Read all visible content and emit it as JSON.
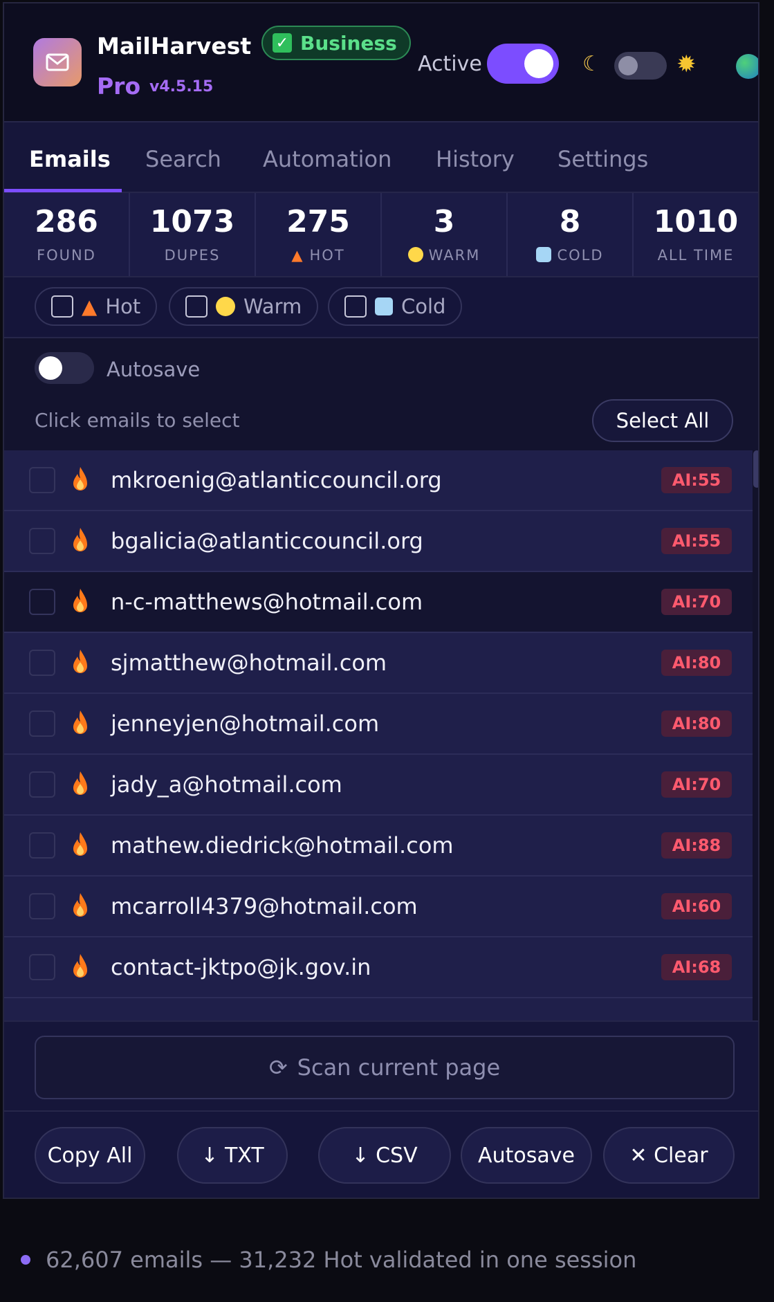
{
  "app": {
    "name": "MailHarvest",
    "tier": "Pro",
    "version": "v4.5.15",
    "plan_badge": "Business",
    "active_label": "Active",
    "active_on": true,
    "dark_mode": true
  },
  "tabs": [
    {
      "label": "Emails",
      "active": true
    },
    {
      "label": "Search",
      "active": false
    },
    {
      "label": "Automation",
      "active": false
    },
    {
      "label": "History",
      "active": false
    },
    {
      "label": "Settings",
      "active": false
    }
  ],
  "stats": [
    {
      "value": "286",
      "label": "FOUND"
    },
    {
      "value": "1073",
      "label": "DUPES"
    },
    {
      "value": "275",
      "label": "HOT"
    },
    {
      "value": "3",
      "label": "WARM"
    },
    {
      "value": "8",
      "label": "COLD"
    },
    {
      "value": "1010",
      "label": "ALL TIME"
    }
  ],
  "filters": [
    {
      "label": "Hot",
      "checked": false
    },
    {
      "label": "Warm",
      "checked": false
    },
    {
      "label": "Cold",
      "checked": false
    }
  ],
  "autosave": {
    "label": "Autosave",
    "enabled": false
  },
  "hint": "Click emails to select",
  "select_all": "Select All",
  "emails": [
    {
      "address": "mkroenig@atlanticcouncil.org",
      "score": "AI:55"
    },
    {
      "address": "bgalicia@atlanticcouncil.org",
      "score": "AI:55"
    },
    {
      "address": "n-c-matthews@hotmail.com",
      "score": "AI:70"
    },
    {
      "address": "sjmatthew@hotmail.com",
      "score": "AI:80"
    },
    {
      "address": "jenneyjen@hotmail.com",
      "score": "AI:80"
    },
    {
      "address": "jady_a@hotmail.com",
      "score": "AI:70"
    },
    {
      "address": "mathew.diedrick@hotmail.com",
      "score": "AI:88"
    },
    {
      "address": "mcarroll4379@hotmail.com",
      "score": "AI:60"
    },
    {
      "address": "contact-jktpo@jk.gov.in",
      "score": "AI:68"
    }
  ],
  "scan_button": "Scan current page",
  "actions": {
    "copy_all": "Copy All",
    "txt": "↓ TXT",
    "csv": "↓ CSV",
    "autosave": "Autosave",
    "clear": "✕ Clear"
  },
  "caption": "62,607 emails — 31,232 Hot validated in one session",
  "colors": {
    "accent": "#7c4dff",
    "hot_badge_text": "#ff5a6e",
    "plan_badge": "#5be08a",
    "background": "#12122a"
  }
}
